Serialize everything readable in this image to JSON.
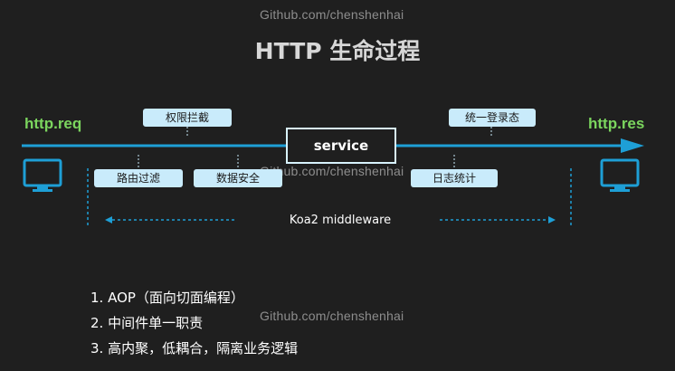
{
  "watermark_top": "Github.com/chenshenhai",
  "watermark_middle": "Github.com/chenshenhai",
  "watermark_bottom": "Github.com/chenshenhai",
  "title": "HTTP 生命过程",
  "http_req": "http.req",
  "http_res": "http.res",
  "service": "service",
  "tags_top": [
    "权限拦截",
    "统一登录态"
  ],
  "tags_bottom": [
    "路由过滤",
    "数据安全",
    "日志统计"
  ],
  "middleware_label": "Koa2 middleware",
  "list": [
    "1. AOP（面向切面编程）",
    "2. 中间件单一职责",
    "3. 高内聚，低耦合，隔离业务逻辑"
  ],
  "colors": {
    "arrow": "#1e9fd6",
    "green": "#7bd55e",
    "tag_bg": "#c9ebfb",
    "monitor": "#1e9fd6",
    "background": "#1f1f1f"
  },
  "icons": [
    "monitor-icon",
    "monitor-icon"
  ]
}
